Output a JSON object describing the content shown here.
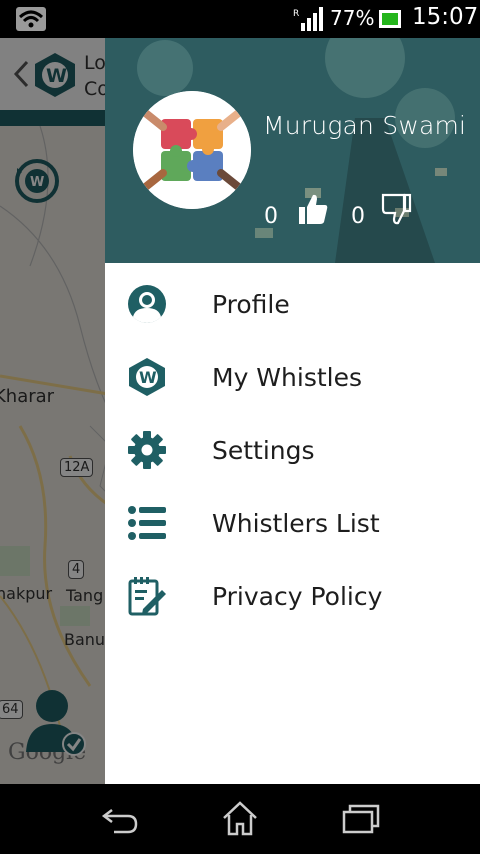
{
  "status_bar": {
    "battery_percent": "77%",
    "time": "15:07",
    "signal_roaming": "R"
  },
  "app": {
    "toolbar_text_line1": "Lo",
    "toolbar_text_line2": "Co",
    "map_labels": {
      "kharar": "Kharar",
      "nakpur": "nakpur",
      "tang": "Tang",
      "banu": "Banu"
    },
    "shields": {
      "r12a": "12A",
      "r4": "4",
      "r64": "64"
    },
    "google": "Google"
  },
  "drawer": {
    "user_name": "Murugan Swami",
    "likes": "0",
    "dislikes": "0",
    "menu": [
      {
        "label": "Profile",
        "icon": "profile-icon"
      },
      {
        "label": "My Whistles",
        "icon": "whistle-logo-icon"
      },
      {
        "label": "Settings",
        "icon": "gear-icon"
      },
      {
        "label": "Whistlers List",
        "icon": "list-icon"
      },
      {
        "label": "Privacy Policy",
        "icon": "edit-document-icon"
      }
    ]
  },
  "colors": {
    "accent": "#1f5f64",
    "drawer_bg": "#ffffff",
    "status_bar": "#000000"
  }
}
